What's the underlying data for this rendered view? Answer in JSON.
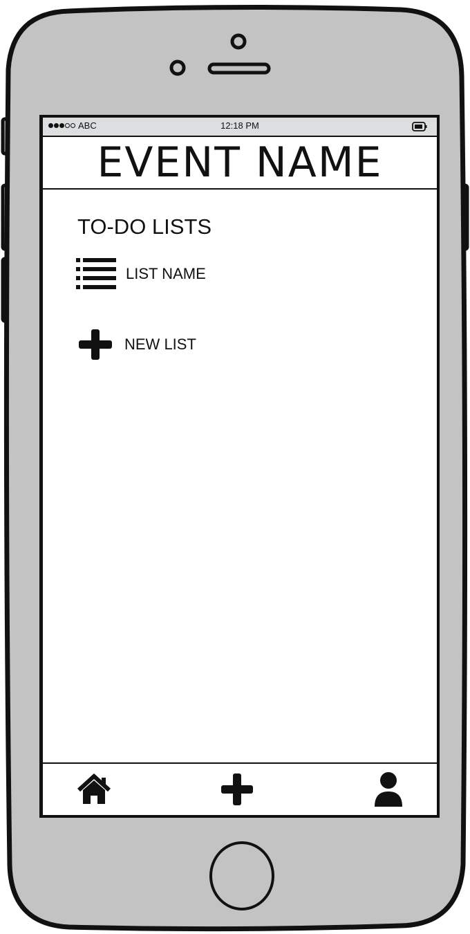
{
  "status_bar": {
    "carrier": "ABC",
    "time": "12:18 PM",
    "signal_bars_filled": 3,
    "signal_bars_total": 5
  },
  "header": {
    "title": "EVENT NAME"
  },
  "todo": {
    "section_title": "TO-DO LISTS",
    "lists": [
      {
        "label": "LIST NAME",
        "icon": "list-icon"
      }
    ],
    "new_list_label": "NEW LIST",
    "new_list_icon": "plus-icon"
  },
  "tab_bar": {
    "items": [
      {
        "icon": "home-icon"
      },
      {
        "icon": "plus-icon"
      },
      {
        "icon": "user-icon"
      }
    ]
  },
  "colors": {
    "phone_body": "#c3c3c3",
    "outline": "#111111",
    "screen": "#ffffff",
    "status_bar": "#dcdedf"
  }
}
